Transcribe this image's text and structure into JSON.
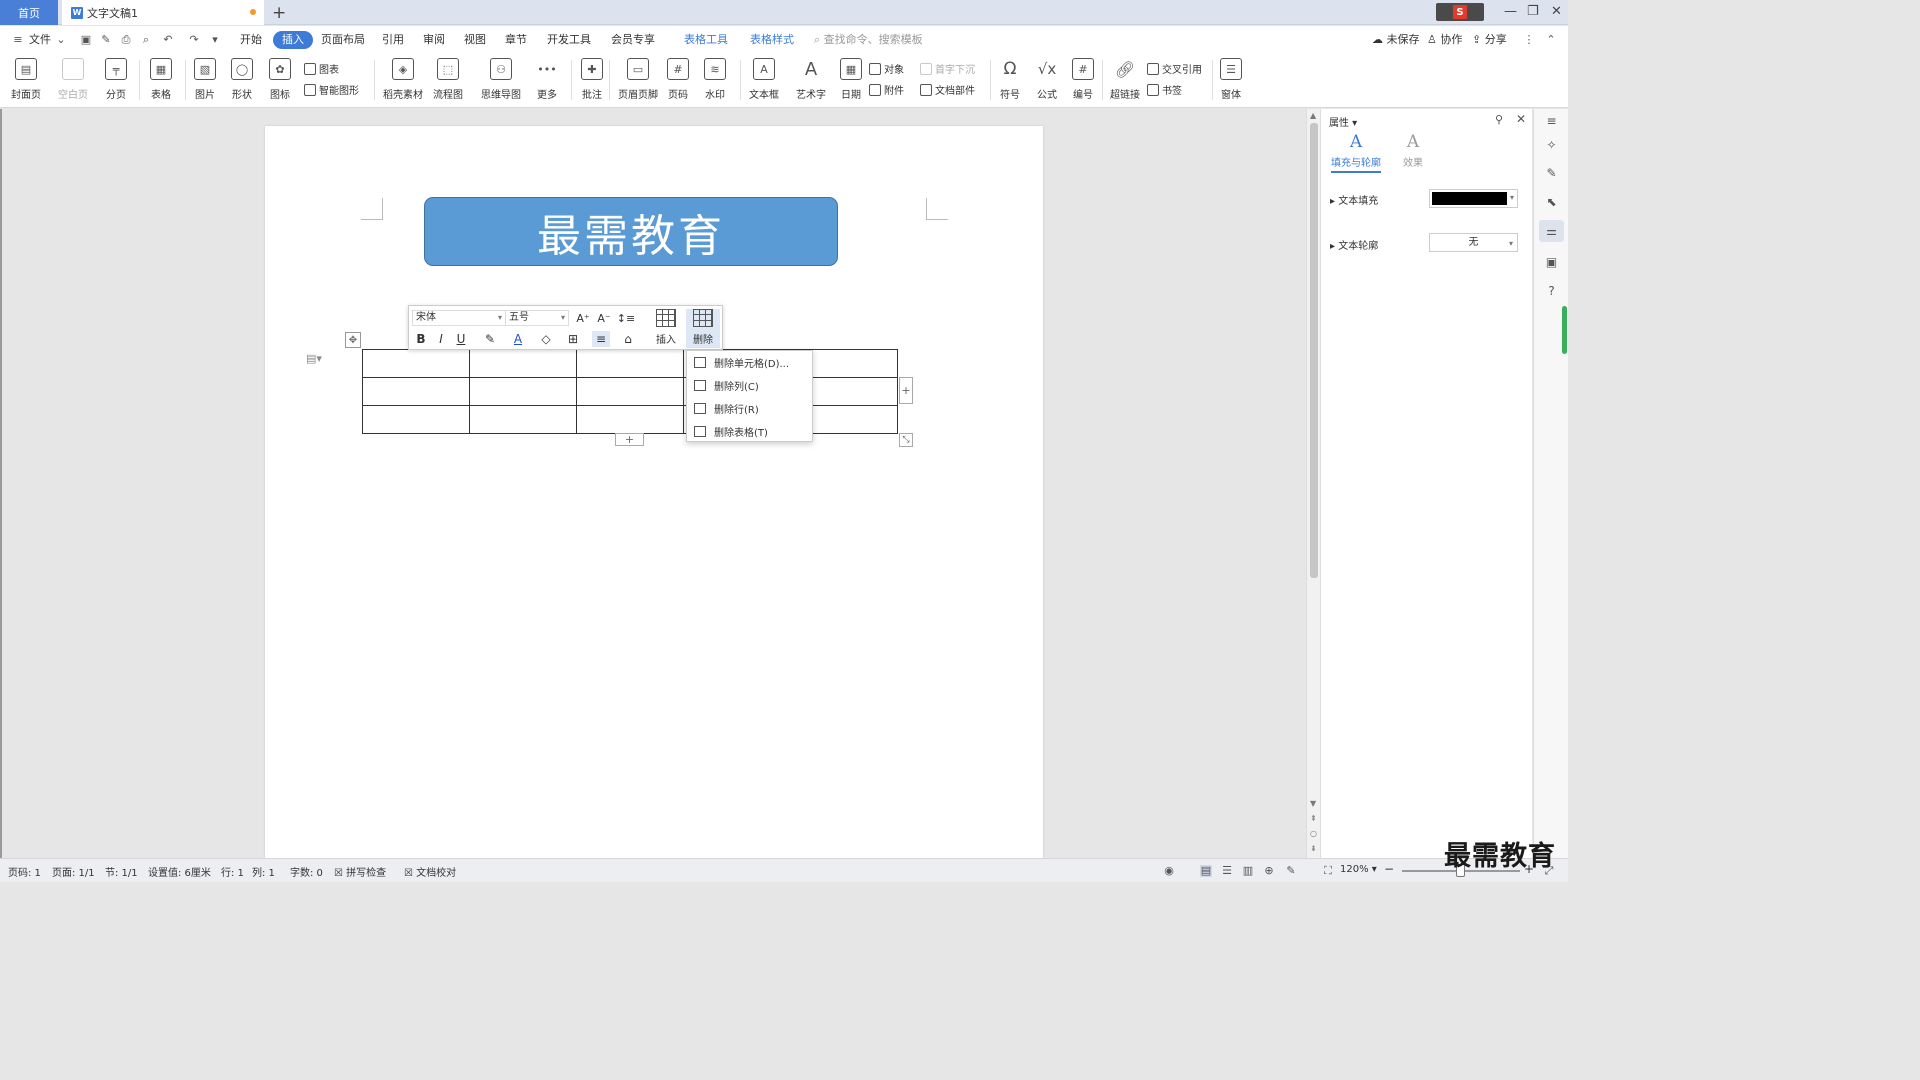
{
  "tabs": {
    "home": "首页",
    "doc_title": "文字文稿1",
    "doc_icon": "W",
    "add": "+"
  },
  "window": {
    "minimize": "—",
    "restore": "❐",
    "close": "✕"
  },
  "menu": {
    "file": "文件",
    "items": [
      "开始",
      "插入",
      "页面布局",
      "引用",
      "审阅",
      "视图",
      "章节",
      "开发工具",
      "会员专享"
    ],
    "active": "插入",
    "context_tabs": [
      "表格工具",
      "表格样式"
    ],
    "search_placeholder": "查找命令、搜索模板",
    "unsaved": "未保存",
    "collaborate": "协作",
    "share": "分享"
  },
  "ribbon": {
    "cover": "封面页",
    "blank": "空白页",
    "pagebreak": "分页",
    "table": "表格",
    "picture": "图片",
    "shape": "形状",
    "icons": "图标",
    "chart": "图表",
    "smartart": "智能图形",
    "material": "稻壳素材",
    "flowchart": "流程图",
    "mindmap": "思维导图",
    "more": "更多",
    "comment": "批注",
    "header_footer": "页眉页脚",
    "page_number": "页码",
    "watermark": "水印",
    "textbox": "文本框",
    "wordart": "艺术字",
    "date": "日期",
    "object": "对象",
    "attachment": "附件",
    "dropcap": "首字下沉",
    "docparts": "文档部件",
    "symbol": "符号",
    "formula": "公式",
    "numbering": "编号",
    "hyperlink": "超链接",
    "crossref": "交叉引用",
    "bookmark": "书签",
    "window": "窗体"
  },
  "document": {
    "banner_text": "最需教育",
    "table_rows": 3,
    "table_cols": 5
  },
  "mini_toolbar": {
    "font": "宋体",
    "size": "五号",
    "bold": "B",
    "italic": "I",
    "underline": "U",
    "insert": "插入",
    "delete": "删除"
  },
  "delete_menu": {
    "items": [
      "删除单元格(D)...",
      "删除列(C)",
      "删除行(R)",
      "删除表格(T)"
    ]
  },
  "panel": {
    "title": "属性",
    "tab_fill": "填充与轮廓",
    "tab_effect": "效果",
    "text_fill": "文本填充",
    "text_fill_color": "#000000",
    "text_outline": "文本轮廓",
    "text_outline_value": "无"
  },
  "status": {
    "page_no": "页码: 1",
    "pages": "页面: 1/1",
    "section": "节: 1/1",
    "setting": "设置值: 6厘米",
    "row": "行: 1",
    "col": "列: 1",
    "word_count": "字数: 0",
    "spell_check": "拼写检查",
    "doc_check": "文档校对",
    "zoom": "120%"
  },
  "watermark_text": "最需教育",
  "colors": {
    "accent": "#3d7bd6",
    "banner": "#5b9bd5",
    "rail_indicator": "#3aaf5b"
  }
}
